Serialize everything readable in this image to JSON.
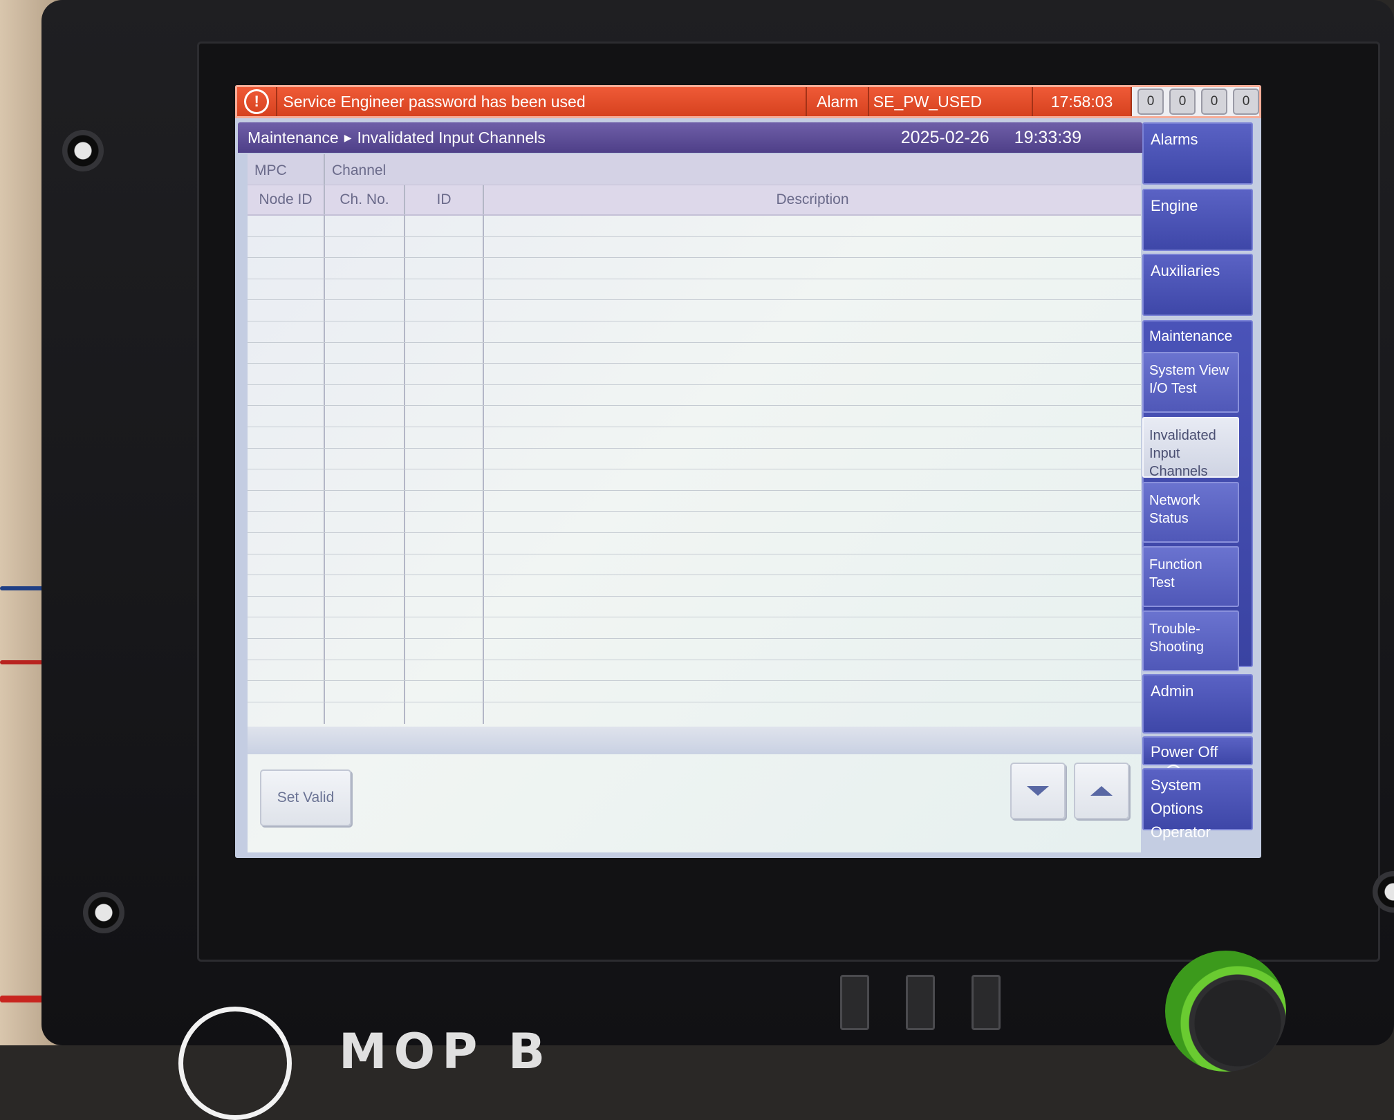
{
  "alarm": {
    "message": "Service Engineer password has been used",
    "type": "Alarm",
    "code": "SE_PW_USED",
    "time": "17:58:03",
    "counters": [
      "0",
      "0",
      "0",
      "0"
    ],
    "color": "#e04b28"
  },
  "header": {
    "breadcrumb": [
      "Maintenance",
      "Invalidated Input Channels"
    ],
    "date": "2025-02-26",
    "time": "19:33:39"
  },
  "table": {
    "group_headers": [
      "MPC",
      "Channel"
    ],
    "columns": [
      "Node ID",
      "Ch. No.",
      "ID",
      "Description"
    ],
    "rows": []
  },
  "buttons": {
    "set_valid": "Set Valid",
    "scroll_down": "chevron-down-icon",
    "scroll_up": "chevron-up-icon"
  },
  "nav": {
    "alarms": "Alarms",
    "engine": "Engine",
    "auxiliaries": "Auxiliaries",
    "maintenance": "Maintenance",
    "sub": [
      {
        "line1": "System View",
        "line2": "I/O Test"
      },
      {
        "line1": "Invalidated",
        "line2": "Input Channels"
      },
      {
        "line1": "Network",
        "line2": "Status"
      },
      {
        "line1": "Function",
        "line2": "Test"
      },
      {
        "line1": "Trouble-",
        "line2": "Shooting"
      }
    ],
    "admin": "Admin",
    "power_off": "Power Off",
    "system_options": "System Options",
    "operator": "Operator"
  },
  "device": {
    "brand": "MOP B"
  }
}
